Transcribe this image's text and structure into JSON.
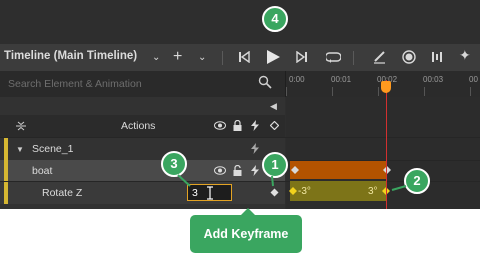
{
  "header": {
    "title": "Timeline (Main Timeline)",
    "add": "+",
    "play_callout": "4"
  },
  "search": {
    "placeholder": "Search Element & Animation"
  },
  "ruler": {
    "ticks": [
      "0:00",
      "00:01",
      "00:02",
      "00:03",
      "00"
    ]
  },
  "actions_row": {
    "label": "Actions"
  },
  "tree": {
    "scene": "Scene_1",
    "element": "boat",
    "property": "Rotate Z",
    "property_value": "3"
  },
  "keyframes": {
    "start_value": "-3°",
    "end_value": "3°"
  },
  "callouts": {
    "one": "1",
    "two": "2",
    "three": "3"
  },
  "add_keyframe": {
    "label": "Add Keyframe"
  },
  "colors": {
    "callout": "#3aa660",
    "playhead": "#d23030",
    "property_bar": "#7d7418",
    "element_bar": "#b35300"
  },
  "icons": [
    "chevron-down-icon",
    "plus-icon",
    "jump-start-icon",
    "play-icon",
    "jump-end-icon",
    "loop-icon",
    "edit-icon",
    "record-icon",
    "snap-icon",
    "magic-icon",
    "search-icon",
    "eye-icon",
    "lock-icon",
    "lightning-icon",
    "keyframe-diamond-icon",
    "text-cursor-icon"
  ]
}
